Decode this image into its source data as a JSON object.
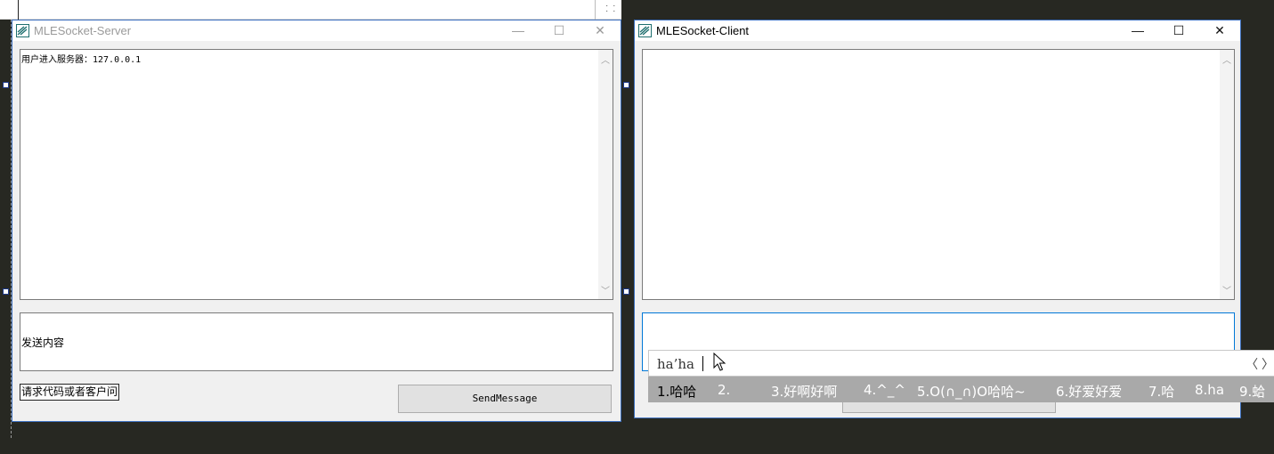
{
  "server": {
    "title": "MLESocket-Server",
    "log_lines": [
      "用户进入服务器：127.0.0.1"
    ],
    "input_text": "发送内容",
    "request_button": "请求代码或者客户问",
    "send_button": "SendMessage"
  },
  "client": {
    "title": "MLESocket-Client",
    "log_lines": [],
    "input_text": ""
  },
  "titlebar_buttons": {
    "minimize": "—",
    "maximize": "☐",
    "close": "✕"
  },
  "ime": {
    "composition": "ha’ha",
    "nav": "〈 〉",
    "candidates": [
      "1.哈哈",
      "2.",
      "3.好啊好啊",
      "4.^_^",
      "5.O(∩_∩)O哈哈~",
      "6.好爱好爱",
      "7.哈",
      "8.ha",
      "9.蛤"
    ]
  },
  "colors": {
    "desktop": "#272822",
    "window_border": "#3c6fbe",
    "focus_border": "#0078d7",
    "ime_bar": "#a9a9a9"
  }
}
